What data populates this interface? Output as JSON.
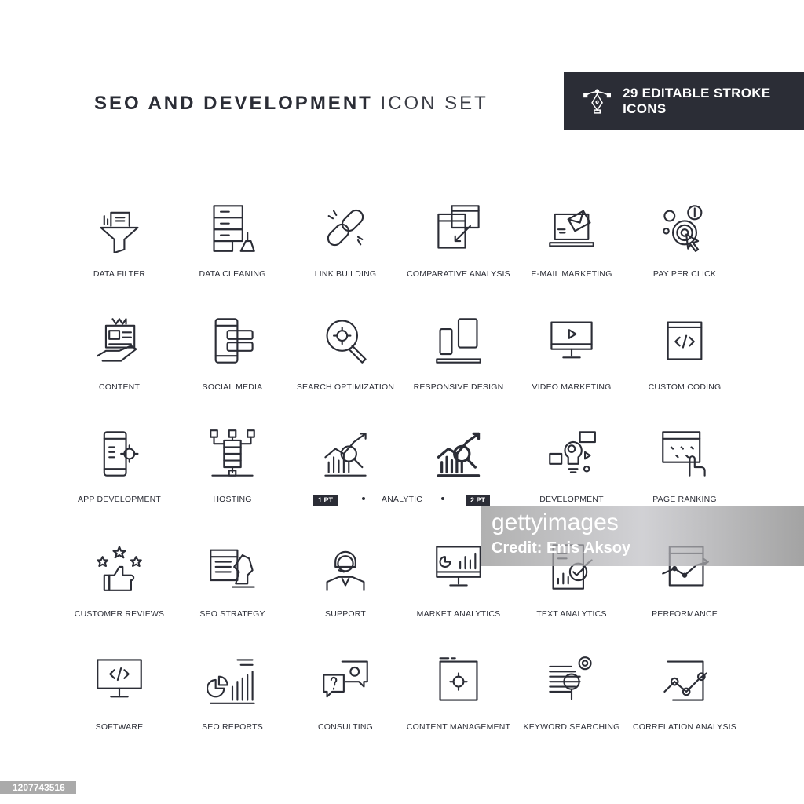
{
  "header": {
    "title_bold": "SEO AND DEVELOPMENT",
    "title_light": "ICON SET",
    "badge_text": "29 EDITABLE STROKE ICONS",
    "badge_icon": "pen-tool-icon"
  },
  "colors": {
    "ink": "#2b2d36",
    "badge_bg": "#2b2d36"
  },
  "icons": [
    {
      "label": "DATA FILTER",
      "icon": "funnel"
    },
    {
      "label": "DATA CLEANING",
      "icon": "server-broom"
    },
    {
      "label": "LINK BUILDING",
      "icon": "chain-link"
    },
    {
      "label": "COMPARATIVE ANALYSIS",
      "icon": "windows-arrows"
    },
    {
      "label": "E-MAIL MARKETING",
      "icon": "laptop-envelope"
    },
    {
      "label": "PAY PER CLICK",
      "icon": "target-cursor"
    },
    {
      "label": "CONTENT",
      "icon": "hand-document"
    },
    {
      "label": "SOCIAL MEDIA",
      "icon": "phone-chat"
    },
    {
      "label": "SEARCH OPTIMIZATION",
      "icon": "magnifier-gear"
    },
    {
      "label": "RESPONSIVE DESIGN",
      "icon": "devices"
    },
    {
      "label": "VIDEO MARKETING",
      "icon": "monitor-play"
    },
    {
      "label": "CUSTOM CODING",
      "icon": "window-code"
    },
    {
      "label": "APP DEVELOPMENT",
      "icon": "phone-gear"
    },
    {
      "label": "HOSTING",
      "icon": "server-network"
    },
    {
      "label": "",
      "icon": "chart-magnifier-thin"
    },
    {
      "label": "",
      "icon": "chart-magnifier-thick"
    },
    {
      "label": "DEVELOPMENT",
      "icon": "bulb-ideas"
    },
    {
      "label": "PAGE RANKING",
      "icon": "window-stars-hand"
    },
    {
      "label": "CUSTOMER REVIEWS",
      "icon": "thumb-stars"
    },
    {
      "label": "SEO STRATEGY",
      "icon": "document-knight"
    },
    {
      "label": "SUPPORT",
      "icon": "headset-person"
    },
    {
      "label": "MARKET ANALYTICS",
      "icon": "monitor-chart"
    },
    {
      "label": "TEXT ANALYTICS",
      "icon": "document-chart"
    },
    {
      "label": "PERFORMANCE",
      "icon": "window-line-chart"
    },
    {
      "label": "SOFTWARE",
      "icon": "monitor-code"
    },
    {
      "label": "SEO REPORTS",
      "icon": "pie-bars"
    },
    {
      "label": "CONSULTING",
      "icon": "speech-bubbles"
    },
    {
      "label": "CONTENT MANAGEMENT",
      "icon": "window-gear"
    },
    {
      "label": "KEYWORD SEARCHING",
      "icon": "text-magnifier"
    },
    {
      "label": "CORRELATION ANALYSIS",
      "icon": "frame-line-chart"
    }
  ],
  "analytic": {
    "label": "ANALYTIC",
    "left_badge": "1 PT",
    "right_badge": "2 PT"
  },
  "watermark": {
    "brand": "gettyimages",
    "credit": "Credit: Enis Aksoy"
  },
  "image_id": "1207743516"
}
